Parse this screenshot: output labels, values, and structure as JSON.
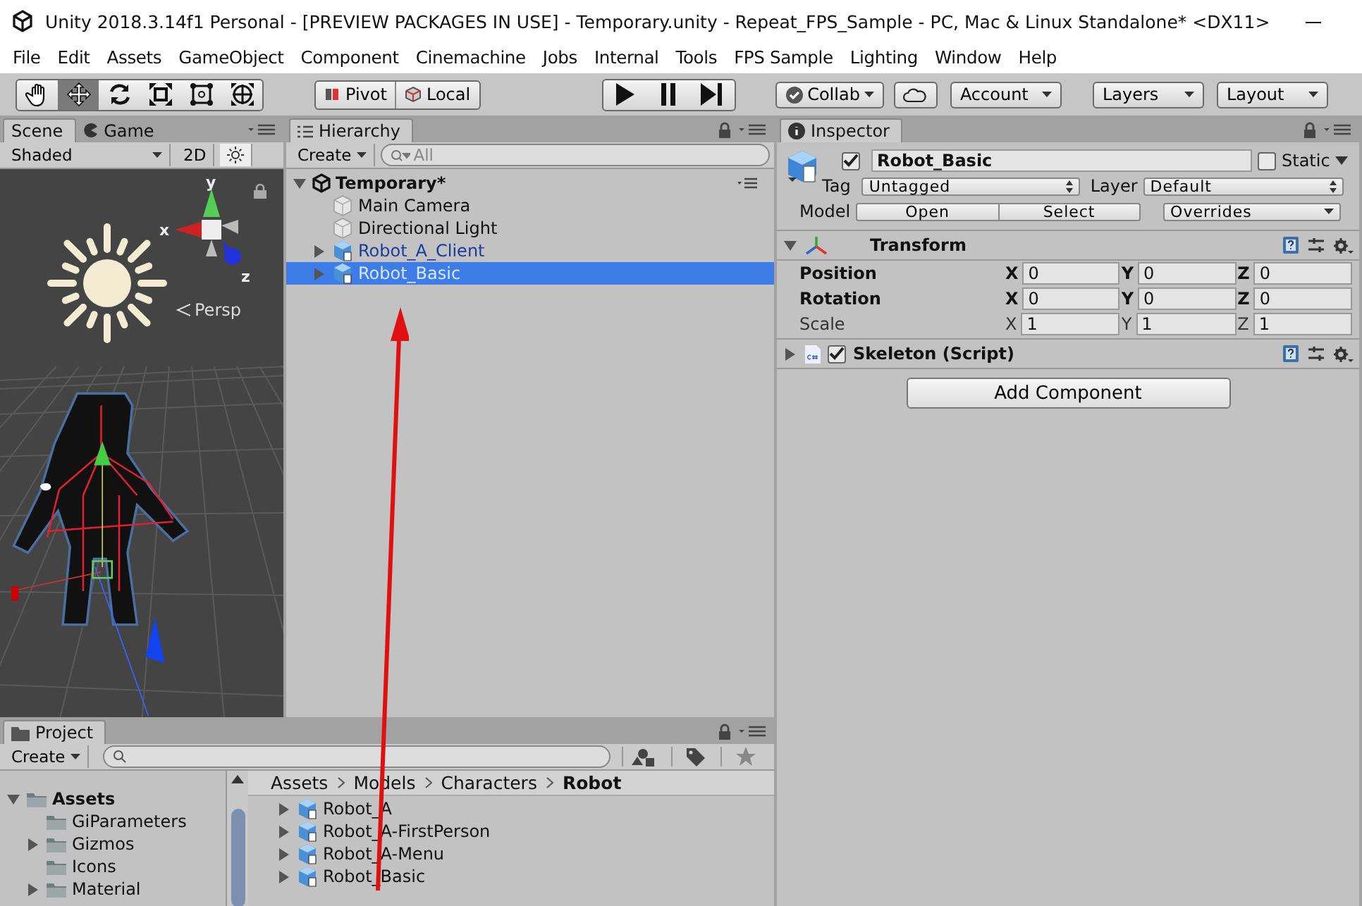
{
  "window": {
    "title": "Unity 2018.3.14f1 Personal - [PREVIEW PACKAGES IN USE] - Temporary.unity - Repeat_FPS_Sample - PC, Mac & Linux Standalone* <DX11>"
  },
  "menu": [
    "File",
    "Edit",
    "Assets",
    "GameObject",
    "Component",
    "Cinemachine",
    "Jobs",
    "Internal",
    "Tools",
    "FPS Sample",
    "Lighting",
    "Window",
    "Help"
  ],
  "toolbar": {
    "tools": [
      {
        "kind": "hand",
        "selected": false
      },
      {
        "kind": "move",
        "selected": true
      },
      {
        "kind": "rotate",
        "selected": false
      },
      {
        "kind": "scale",
        "selected": false
      },
      {
        "kind": "rect",
        "selected": false
      },
      {
        "kind": "transform",
        "selected": false
      }
    ],
    "pivot": "Pivot",
    "space": "Local",
    "collab": "Collab",
    "account": "Account",
    "layers": "Layers",
    "layout": "Layout"
  },
  "scene_panel": {
    "tabs": [
      {
        "label": "Scene",
        "selected": true
      },
      {
        "label": "Game",
        "selected": false
      }
    ],
    "shading": "Shaded",
    "mode_2d": "2D",
    "lighting_on": true,
    "axis_x": "x",
    "axis_y": "y",
    "axis_z": "z",
    "projection": "Persp"
  },
  "hierarchy": {
    "tab": "Hierarchy",
    "create": "Create",
    "search_placeholder": "All",
    "scene": "Temporary*",
    "items": [
      {
        "name": "Main Camera",
        "kind": "gameobject",
        "has_children": false,
        "selected": false
      },
      {
        "name": "Directional Light",
        "kind": "gameobject",
        "has_children": false,
        "selected": false
      },
      {
        "name": "Robot_A_Client",
        "kind": "prefab",
        "has_children": true,
        "selected": false
      },
      {
        "name": "Robot_Basic",
        "kind": "prefab",
        "has_children": true,
        "selected": true
      }
    ]
  },
  "inspector": {
    "tab": "Inspector",
    "active": true,
    "name": "Robot_Basic",
    "static_label": "Static",
    "static": false,
    "tag_label": "Tag",
    "tag": "Untagged",
    "layer_label": "Layer",
    "layer": "Default",
    "model_label": "Model",
    "open": "Open",
    "select": "Select",
    "overrides": "Overrides",
    "components": [
      {
        "kind": "transform",
        "title": "Transform",
        "expanded": true,
        "rows": [
          {
            "label": "Position",
            "modified": true,
            "fields": [
              {
                "axis": "X",
                "value": "0"
              },
              {
                "axis": "Y",
                "value": "0"
              },
              {
                "axis": "Z",
                "value": "0"
              }
            ]
          },
          {
            "label": "Rotation",
            "modified": true,
            "fields": [
              {
                "axis": "X",
                "value": "0"
              },
              {
                "axis": "Y",
                "value": "0"
              },
              {
                "axis": "Z",
                "value": "0"
              }
            ]
          },
          {
            "label": "Scale",
            "modified": false,
            "fields": [
              {
                "axis": "X",
                "value": "1"
              },
              {
                "axis": "Y",
                "value": "1"
              },
              {
                "axis": "Z",
                "value": "1"
              }
            ]
          }
        ]
      },
      {
        "kind": "script",
        "title": "Skeleton (Script)",
        "expanded": false,
        "enabled": true
      }
    ],
    "add_component": "Add Component"
  },
  "project": {
    "tab": "Project",
    "create": "Create",
    "tree": [
      {
        "name": "Assets",
        "expanded": true,
        "children": [
          {
            "name": "GiParameters",
            "has_children": false
          },
          {
            "name": "Gizmos",
            "has_children": true
          },
          {
            "name": "Icons",
            "has_children": false
          },
          {
            "name": "Material",
            "has_children": true
          }
        ]
      }
    ],
    "breadcrumb": [
      "Assets",
      "Models",
      "Characters",
      "Robot"
    ],
    "files": [
      {
        "name": "Robot_A"
      },
      {
        "name": "Robot_A-FirstPerson"
      },
      {
        "name": "Robot_A-Menu"
      },
      {
        "name": "Robot_Basic"
      }
    ]
  }
}
